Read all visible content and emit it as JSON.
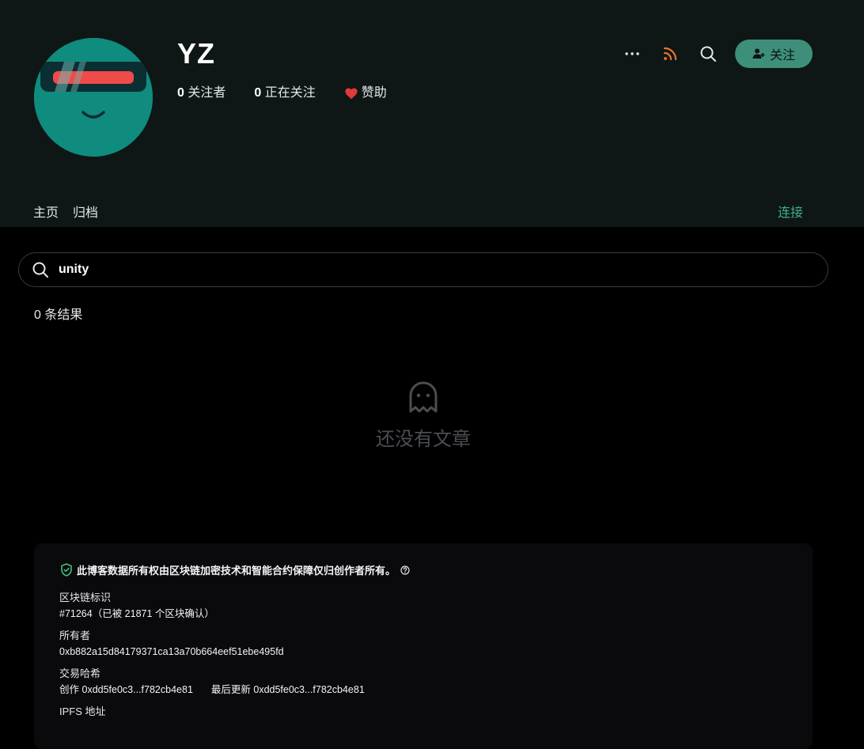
{
  "header": {
    "title": "YZ",
    "followers_count": "0",
    "followers_label": "关注者",
    "following_count": "0",
    "following_label": "正在关注",
    "sponsor_label": "赞助",
    "follow_button_label": "关注",
    "icons": [
      "more-icon",
      "rss-icon",
      "search-icon",
      "add-user-icon"
    ],
    "accent_color": "#3d8f7a",
    "rss_color": "#e8742c"
  },
  "nav": {
    "tabs": [
      {
        "label": "主页"
      },
      {
        "label": "归档"
      }
    ],
    "connect_label": "连接"
  },
  "search": {
    "value": "unity"
  },
  "results": {
    "count_text": "0 条结果",
    "empty_text": "还没有文章"
  },
  "footer": {
    "secure_text": "此博客数据所有权由区块链加密技术和智能合约保障仅归创作者所有。",
    "blockchain_label": "区块链标识",
    "blockchain_value": "#71264（已被 21871 个区块确认）",
    "owner_label": "所有者",
    "owner_value": "0xb882a15d84179371ca13a70b664eef51ebe495fd",
    "tx_label": "交易哈希",
    "tx_created_label": "创作",
    "tx_created_value": "0xdd5fe0c3...f782cb4e81",
    "tx_updated_label": "最后更新",
    "tx_updated_value": "0xdd5fe0c3...f782cb4e81",
    "ipfs_label": "IPFS 地址"
  }
}
